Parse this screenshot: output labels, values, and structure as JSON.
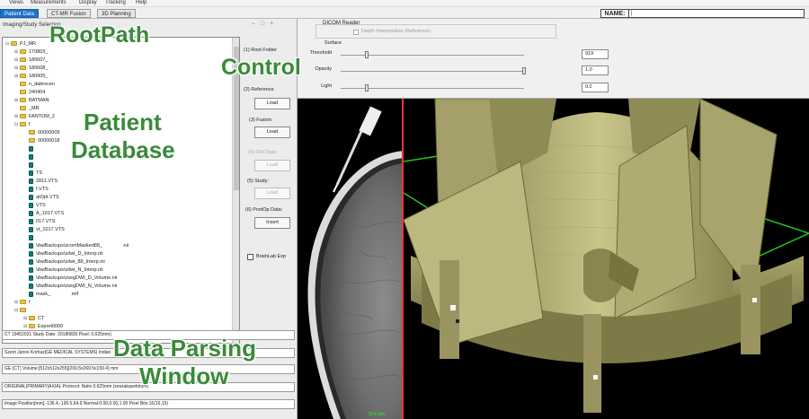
{
  "menu": [
    "Views",
    "Measurements",
    "Display",
    "Tracking",
    "Help"
  ],
  "tabs": [
    {
      "label": "Patient Data",
      "active": true
    },
    {
      "label": "CT-MR Fusion",
      "active": false
    },
    {
      "label": "3D Planning",
      "active": false
    }
  ],
  "name_label": "NAME:",
  "name_value": "|",
  "left_panel": {
    "title": "Imaging/Study Selection",
    "tree": [
      {
        "toggle": "⊟",
        "icon": "folder",
        "label": "PJ_MR",
        "indent": 0
      },
      {
        "toggle": "⊞",
        "icon": "folder",
        "label": "170803_",
        "indent": 1
      },
      {
        "toggle": "⊞",
        "icon": "folder",
        "label": "180607_",
        "indent": 1
      },
      {
        "toggle": "⊞",
        "icon": "folder",
        "label": "180608_",
        "indent": 1
      },
      {
        "toggle": "⊞",
        "icon": "folder",
        "label": "180905_",
        "indent": 1
      },
      {
        "toggle": "",
        "icon": "folder",
        "label": "n_dabrecen",
        "indent": 1
      },
      {
        "toggle": "",
        "icon": "folder",
        "label": "240404",
        "indent": 1
      },
      {
        "toggle": "⊞",
        "icon": "folder",
        "label": "BATMAN",
        "indent": 1
      },
      {
        "toggle": "",
        "icon": "folder",
        "label": "_MR",
        "indent": 1
      },
      {
        "toggle": "⊞",
        "icon": "folder",
        "label": "FANTOM_2",
        "indent": 1
      },
      {
        "toggle": "⊟",
        "icon": "folder",
        "label": "f",
        "indent": 1
      },
      {
        "toggle": "",
        "icon": "folder",
        "label": "00000009",
        "indent": 2
      },
      {
        "toggle": "",
        "icon": "folder",
        "label": "00000018",
        "indent": 2
      },
      {
        "toggle": "",
        "icon": "file",
        "label": "",
        "indent": 2
      },
      {
        "toggle": "",
        "icon": "file",
        "label": "",
        "indent": 2
      },
      {
        "toggle": "",
        "icon": "file",
        "label": "",
        "indent": 2
      },
      {
        "toggle": "",
        "icon": "file",
        "label": "TS",
        "indent": 2
      },
      {
        "toggle": "",
        "icon": "file",
        "label": "2811.VTS",
        "indent": 2
      },
      {
        "toggle": "",
        "icon": "file",
        "label": "f.VTS",
        "indent": 2
      },
      {
        "toggle": "",
        "icon": "file",
        "label": "atOpt.VTS",
        "indent": 2
      },
      {
        "toggle": "",
        "icon": "file",
        "label": "VTS",
        "indent": 2
      },
      {
        "toggle": "",
        "icon": "file",
        "label": "A_1017.VTS",
        "indent": 2
      },
      {
        "toggle": "",
        "icon": "file",
        "label": "017.VTS",
        "indent": 2
      },
      {
        "toggle": "",
        "icon": "file",
        "label": "vt_1017.VTS",
        "indent": 2
      },
      {
        "toggle": "",
        "icon": "file",
        "label": "",
        "indent": 2
      },
      {
        "toggle": "",
        "icon": "file",
        "label": "\\dwiBackups\\zcomMasked88_",
        "suffix": ".nii",
        "indent": 2
      },
      {
        "toggle": "",
        "icon": "file",
        "label": "\\dwiBackups\\zdwi_D_Interp.nii",
        "indent": 2
      },
      {
        "toggle": "",
        "icon": "file",
        "label": "\\dwiBackups\\zdwi_88_Interp.nii",
        "indent": 2
      },
      {
        "toggle": "",
        "icon": "file",
        "label": "\\dwiBackups\\zdwi_N_Interp.nii",
        "indent": 2
      },
      {
        "toggle": "",
        "icon": "file",
        "label": "\\dwiBackups\\zsegDWI_D_Volume.nii",
        "indent": 2
      },
      {
        "toggle": "",
        "icon": "file",
        "label": "\\dwiBackups\\zsegDWI_N_Volume.nii",
        "indent": 2
      },
      {
        "toggle": "",
        "icon": "file",
        "label": "mask_",
        "suffix": ".mif",
        "indent": 2
      },
      {
        "toggle": "⊞",
        "icon": "folder",
        "label": "f",
        "indent": 1
      },
      {
        "toggle": "⊟",
        "icon": "folder",
        "label": "",
        "indent": 1
      },
      {
        "toggle": "⊞",
        "icon": "folder",
        "label": "CT",
        "indent": 2
      },
      {
        "toggle": "⊞",
        "icon": "folder",
        "label": "Export0000",
        "indent": 2
      },
      {
        "toggle": "",
        "icon": "folder",
        "label": "Export0000_8f",
        "indent": 2
      }
    ],
    "controls": {
      "root_folder": "(1) Root Folder",
      "reference": "(2) Reference",
      "reference_btn": "Load",
      "fusion": "(3) Fusion:",
      "fusion_btn": "Load",
      "ohi_data": "(4) OHI Data:",
      "ohi_btn": "Load",
      "study": "(5) Study:",
      "study_btn": "Load",
      "postop": "(6) PostOp Data:",
      "postop_btn": "Insert",
      "brainlab": "BrainLab Exp"
    },
    "info_lines": [
      "CT 19452021 Study Date: 20180830 Pixel: 0.625mm)",
      "Szent Janos Korhaz|GE MEDICAL SYSTEMS|                                   Indian",
      "GE (CT) Volume:[512x512x255](269.5x269.5x159.4) mm",
      "ORIGINAL|PRIMARY|AXIAL Protocol: Nativ 0.625mm (zeszakspektrum)",
      "Image Position[mm]:-136.4,-136.5,64.9 Normal:0.00,0.00,1.00 Pixel Bits:16(16,15)"
    ]
  },
  "dicom_reader": {
    "title": "DICOM Reader",
    "depth_label": "Depth Interpolation (Reference)",
    "surface_label": "Surface",
    "sliders": [
      {
        "label": "Threshold",
        "value": "919",
        "level": 0.14
      },
      {
        "label": "Opacity",
        "value": "1.0",
        "level": 1.0
      },
      {
        "label": "Light",
        "value": "0.2",
        "level": 0.14
      }
    ]
  },
  "ct_readout": "79.4 mm",
  "annotations": {
    "root_path": "RootPath",
    "control": "Control",
    "patient_db_1": "Patient",
    "patient_db_2": "Database",
    "data_parsing_1": "Data Parsing",
    "data_parsing_2": "Window"
  },
  "colors": {
    "accent_tab": "#1a73c9",
    "annotation_green": "#3a8a3a",
    "frame_red": "#e33333",
    "model_olive": "#b9b47a",
    "bbox_green": "#22c422",
    "folder": "#e8c44a",
    "file": "#127d7d"
  }
}
